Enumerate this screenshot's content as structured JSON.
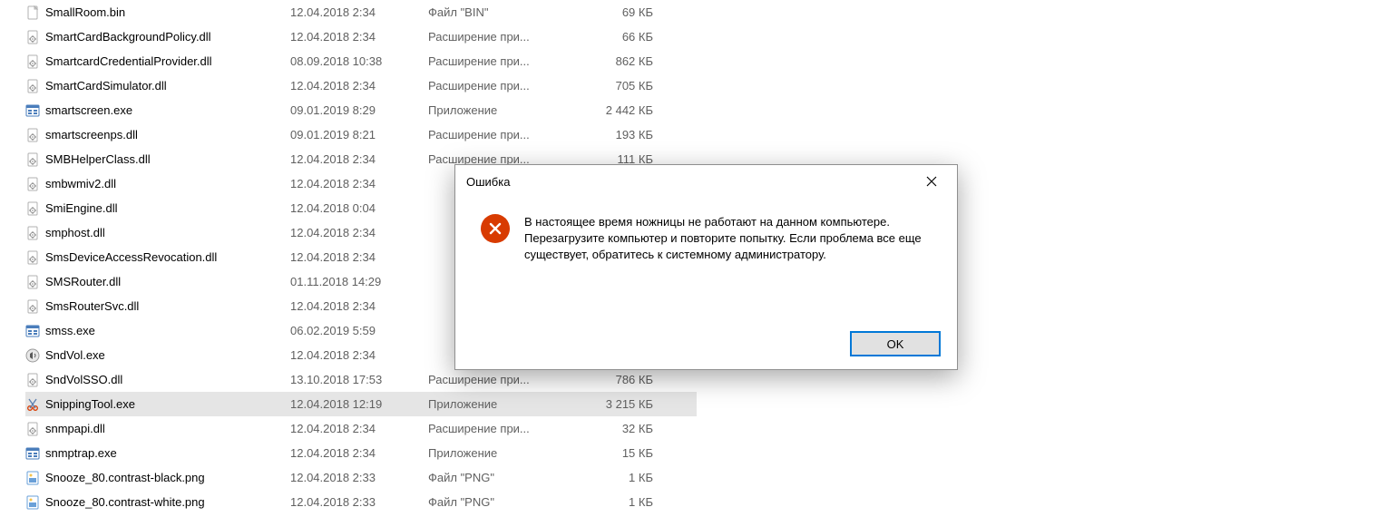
{
  "files": [
    {
      "icon": "bin",
      "name": "SmallRoom.bin",
      "date": "12.04.2018 2:34",
      "type": "Файл \"BIN\"",
      "size": "69 КБ"
    },
    {
      "icon": "dll",
      "name": "SmartCardBackgroundPolicy.dll",
      "date": "12.04.2018 2:34",
      "type": "Расширение при...",
      "size": "66 КБ"
    },
    {
      "icon": "dll",
      "name": "SmartcardCredentialProvider.dll",
      "date": "08.09.2018 10:38",
      "type": "Расширение при...",
      "size": "862 КБ"
    },
    {
      "icon": "dll",
      "name": "SmartCardSimulator.dll",
      "date": "12.04.2018 2:34",
      "type": "Расширение при...",
      "size": "705 КБ"
    },
    {
      "icon": "exe",
      "name": "smartscreen.exe",
      "date": "09.01.2019 8:29",
      "type": "Приложение",
      "size": "2 442 КБ"
    },
    {
      "icon": "dll",
      "name": "smartscreenps.dll",
      "date": "09.01.2019 8:21",
      "type": "Расширение при...",
      "size": "193 КБ"
    },
    {
      "icon": "dll",
      "name": "SMBHelperClass.dll",
      "date": "12.04.2018 2:34",
      "type": "Расширение при...",
      "size": "111 КБ"
    },
    {
      "icon": "dll",
      "name": "smbwmiv2.dll",
      "date": "12.04.2018 2:34",
      "type": "",
      "size": ""
    },
    {
      "icon": "dll",
      "name": "SmiEngine.dll",
      "date": "12.04.2018 0:04",
      "type": "",
      "size": ""
    },
    {
      "icon": "dll",
      "name": "smphost.dll",
      "date": "12.04.2018 2:34",
      "type": "",
      "size": ""
    },
    {
      "icon": "dll",
      "name": "SmsDeviceAccessRevocation.dll",
      "date": "12.04.2018 2:34",
      "type": "",
      "size": ""
    },
    {
      "icon": "dll",
      "name": "SMSRouter.dll",
      "date": "01.11.2018 14:29",
      "type": "",
      "size": ""
    },
    {
      "icon": "dll",
      "name": "SmsRouterSvc.dll",
      "date": "12.04.2018 2:34",
      "type": "",
      "size": ""
    },
    {
      "icon": "exe",
      "name": "smss.exe",
      "date": "06.02.2019 5:59",
      "type": "",
      "size": ""
    },
    {
      "icon": "vol",
      "name": "SndVol.exe",
      "date": "12.04.2018 2:34",
      "type": "",
      "size": ""
    },
    {
      "icon": "dll",
      "name": "SndVolSSO.dll",
      "date": "13.10.2018 17:53",
      "type": "Расширение при...",
      "size": "786 КБ"
    },
    {
      "icon": "snip",
      "name": "SnippingTool.exe",
      "date": "12.04.2018 12:19",
      "type": "Приложение",
      "size": "3 215 КБ",
      "selected": true
    },
    {
      "icon": "dll",
      "name": "snmpapi.dll",
      "date": "12.04.2018 2:34",
      "type": "Расширение при...",
      "size": "32 КБ"
    },
    {
      "icon": "exe",
      "name": "snmptrap.exe",
      "date": "12.04.2018 2:34",
      "type": "Приложение",
      "size": "15 КБ"
    },
    {
      "icon": "png",
      "name": "Snooze_80.contrast-black.png",
      "date": "12.04.2018 2:33",
      "type": "Файл \"PNG\"",
      "size": "1 КБ"
    },
    {
      "icon": "png",
      "name": "Snooze_80.contrast-white.png",
      "date": "12.04.2018 2:33",
      "type": "Файл \"PNG\"",
      "size": "1 КБ"
    }
  ],
  "dialog": {
    "title": "Ошибка",
    "message": "В настоящее время ножницы не работают на данном компьютере. Перезагрузите компьютер и повторите попытку. Если проблема все еще существует, обратитесь к системному администратору.",
    "ok": "OK"
  },
  "icons": {
    "bin": "file-bin-icon",
    "dll": "file-dll-icon",
    "exe": "file-exe-icon",
    "vol": "file-sndvol-icon",
    "snip": "file-snipping-icon",
    "png": "file-png-icon"
  }
}
